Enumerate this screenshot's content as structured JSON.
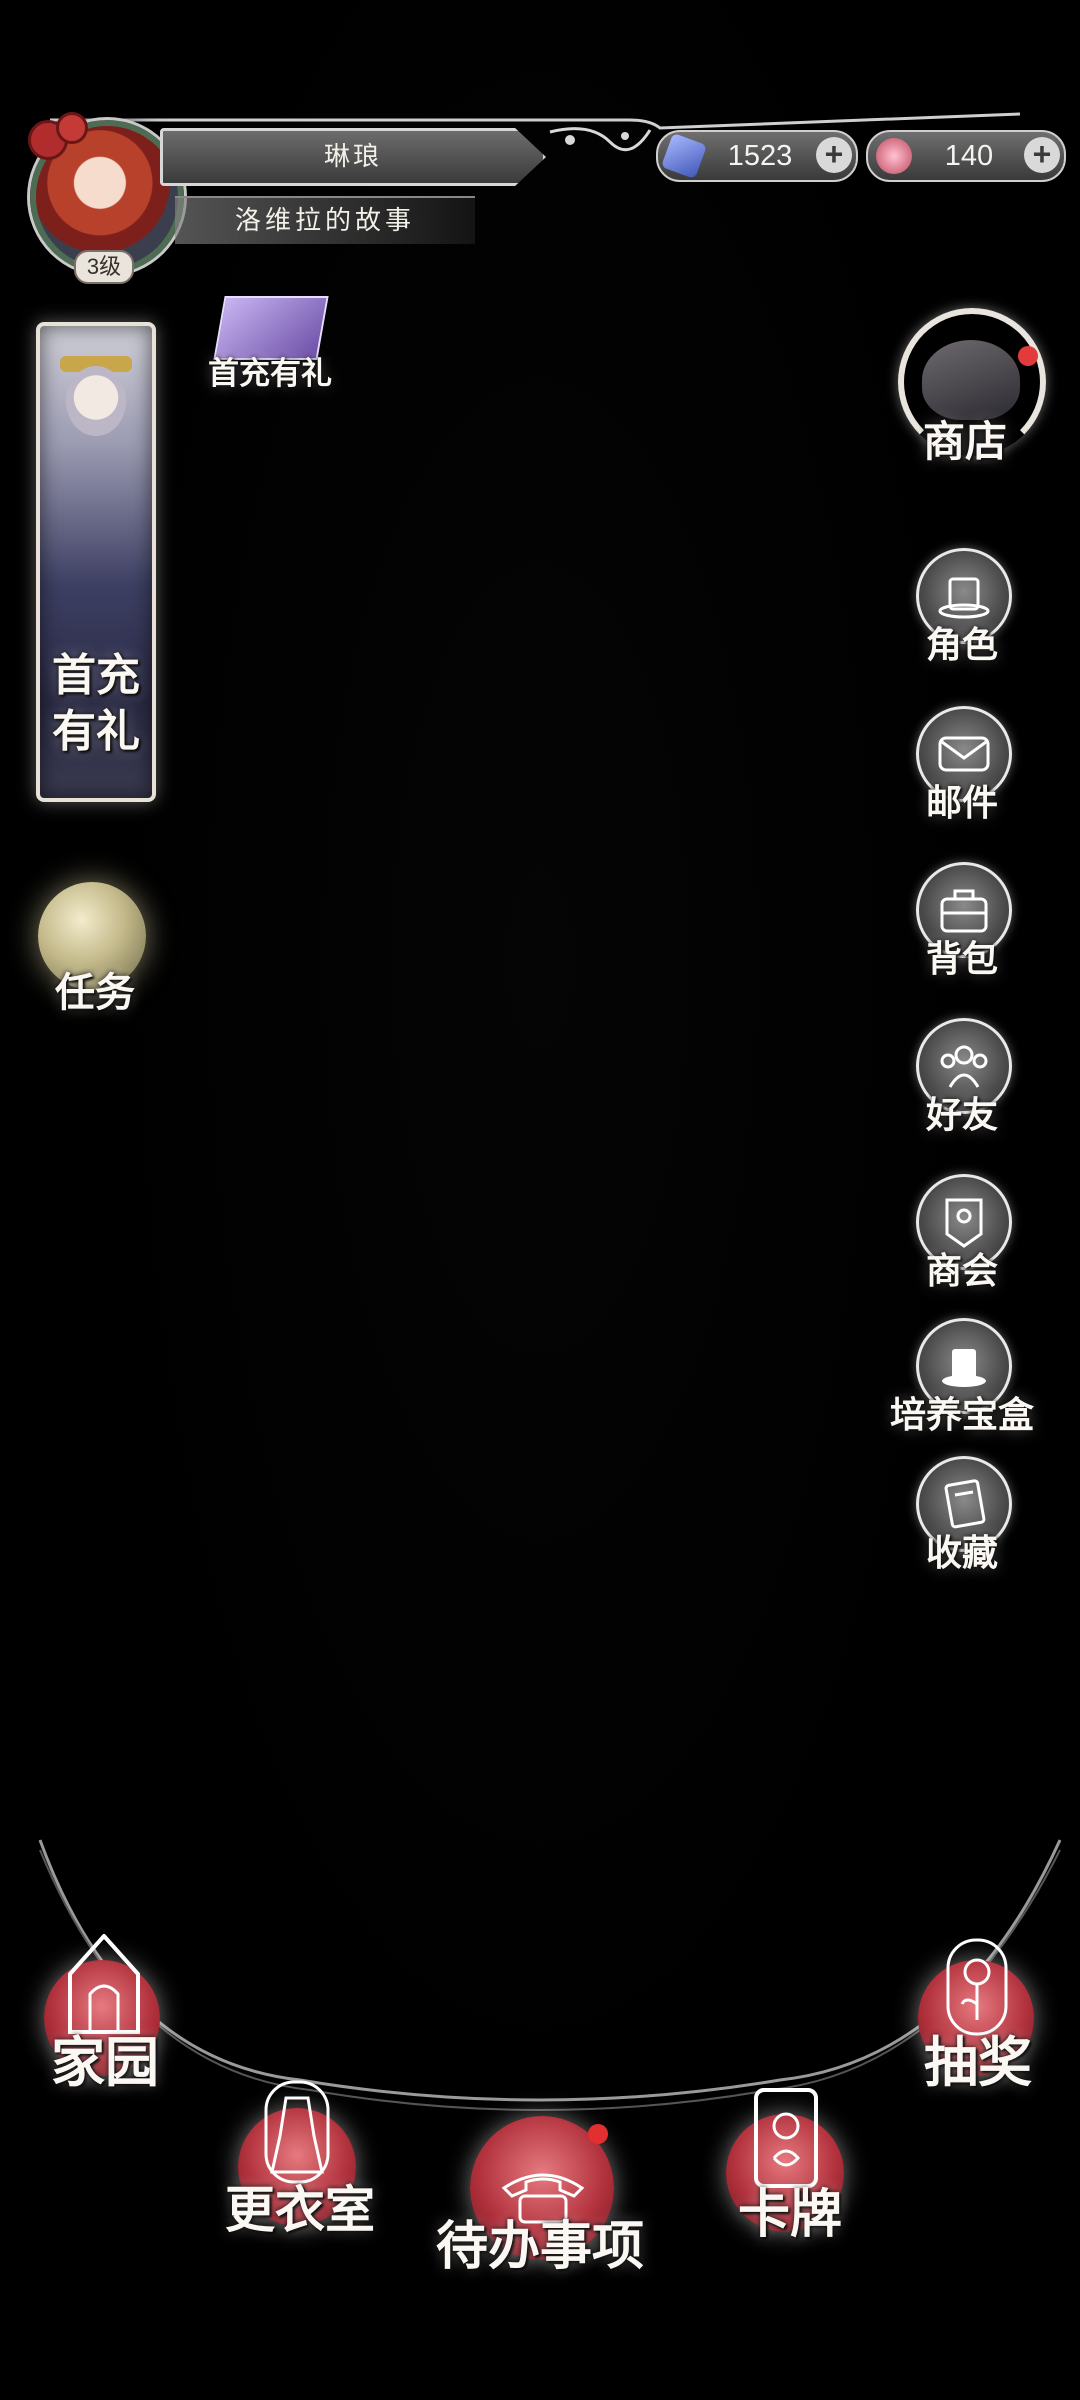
{
  "header": {
    "player_name": "琳琅",
    "story_title": "洛维拉的故事",
    "level": "3级"
  },
  "currencies": [
    {
      "name": "blue-gem",
      "value": "1523"
    },
    {
      "name": "pink-gem",
      "value": "140"
    }
  ],
  "left": {
    "gift_small_label": "首充有礼",
    "banner_line1": "首充",
    "banner_line2": "有礼",
    "task_label": "任务"
  },
  "right": {
    "shop_label": "商店",
    "menu": [
      {
        "label": "角色",
        "icon": "top-hat-icon"
      },
      {
        "label": "邮件",
        "icon": "envelope-icon"
      },
      {
        "label": "背包",
        "icon": "bag-icon"
      },
      {
        "label": "好友",
        "icon": "friends-icon"
      },
      {
        "label": "商会",
        "icon": "guild-banner-icon"
      },
      {
        "label": "培养宝盒",
        "icon": "hat-box-icon"
      },
      {
        "label": "收藏",
        "icon": "book-icon"
      }
    ]
  },
  "bottom_nav": {
    "home": "家园",
    "wardrobe": "更衣室",
    "todo": "待办事项",
    "cards": "卡牌",
    "lottery": "抽奖"
  },
  "colors": {
    "background": "#000000",
    "nav_orb": "#b2323d",
    "notification": "#e32f2f",
    "text": "#fbf7f2"
  }
}
